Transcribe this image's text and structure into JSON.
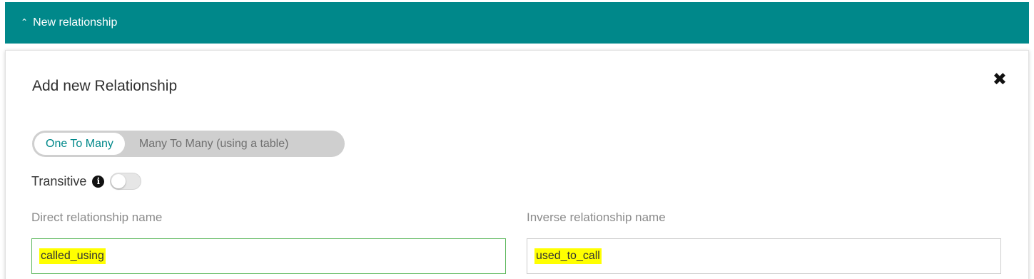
{
  "accordion": {
    "label": "New relationship"
  },
  "panel": {
    "title": "Add new Relationship",
    "close_glyph": "✖"
  },
  "relationship_type": {
    "options": [
      "One To Many",
      "Many To Many (using a table)"
    ],
    "selected": "One To Many"
  },
  "transitive": {
    "label": "Transitive",
    "info_glyph": "i",
    "enabled": false
  },
  "fields": {
    "direct": {
      "label": "Direct relationship name",
      "value": "called_using"
    },
    "inverse": {
      "label": "Inverse relationship name",
      "value": "used_to_call"
    }
  },
  "colors": {
    "accent": "#00888a",
    "highlight": "#ffff00",
    "valid_border": "#5cb85c"
  },
  "icons": {
    "expand": "chevron-up-icon",
    "close": "close-icon",
    "info": "info-icon"
  }
}
